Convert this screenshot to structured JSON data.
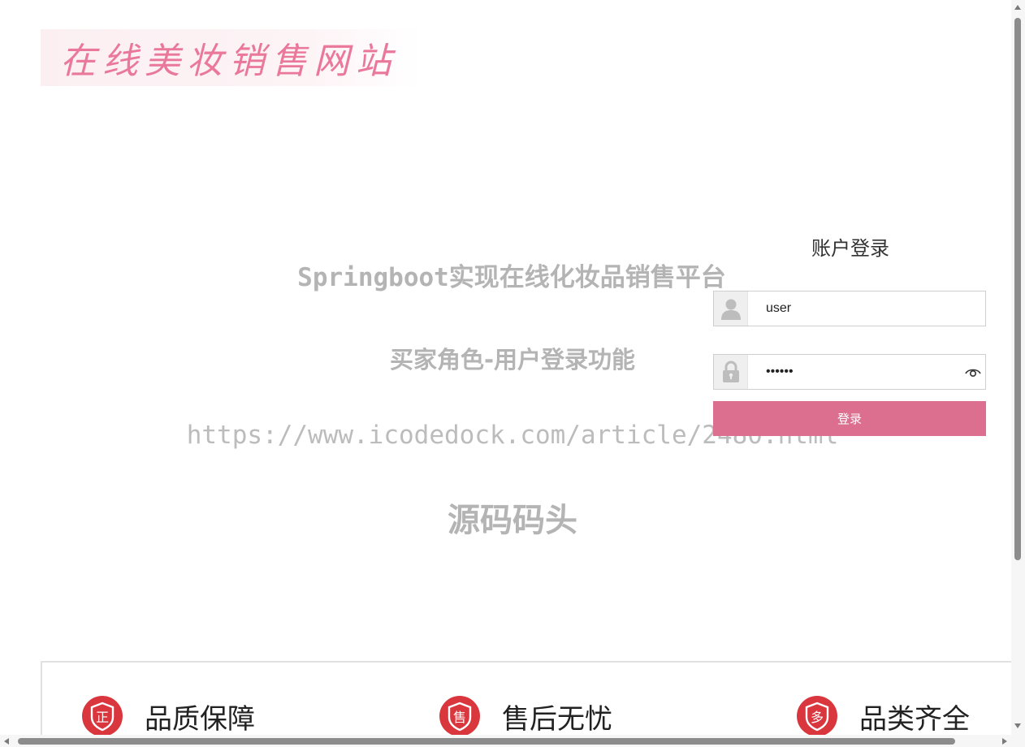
{
  "header": {
    "logo_text": "在线美妆销售网站"
  },
  "watermark": {
    "line1": "Springboot实现在线化妆品销售平台",
    "line2": "买家角色-用户登录功能",
    "line3": "https://www.icodedock.com/article/2480.html",
    "line4": "源码码头"
  },
  "login": {
    "title": "账户登录",
    "username_value": "user",
    "password_value": "123456",
    "submit_label": "登录"
  },
  "features": [
    {
      "badge": "正",
      "label": "品质保障"
    },
    {
      "badge": "售",
      "label": "售后无忧"
    },
    {
      "badge": "多",
      "label": "品类齐全"
    }
  ],
  "colors": {
    "accent": "#dc6f90",
    "logo": "#e9789a",
    "badge": "#d9363e"
  }
}
